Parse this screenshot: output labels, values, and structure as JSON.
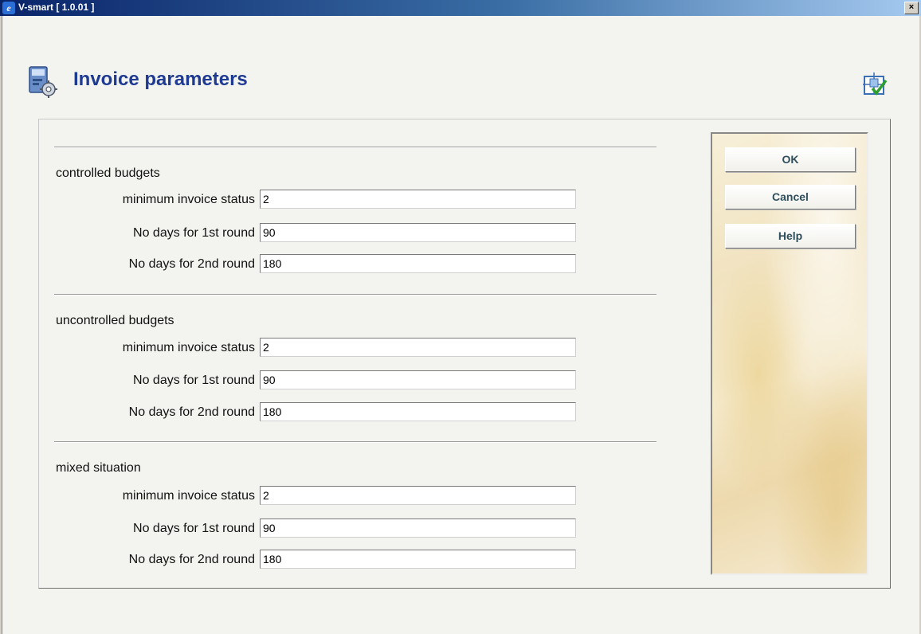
{
  "window": {
    "title": "V-smart [ 1.0.01 ]",
    "close_glyph": "×"
  },
  "page": {
    "title": "Invoice parameters"
  },
  "icons": {
    "app": "ie-icon",
    "page": "parameters-icon",
    "help": "help-link-icon"
  },
  "sections": [
    {
      "label": "controlled budgets",
      "fields": [
        {
          "label": "minimum invoice status",
          "value": "2"
        },
        {
          "label": "No days for 1st round",
          "value": "90"
        },
        {
          "label": "No days for 2nd round",
          "value": "180"
        }
      ]
    },
    {
      "label": "uncontrolled budgets",
      "fields": [
        {
          "label": "minimum invoice status",
          "value": "2"
        },
        {
          "label": "No days for 1st round",
          "value": "90"
        },
        {
          "label": "No days for 2nd round",
          "value": "180"
        }
      ]
    },
    {
      "label": "mixed situation",
      "fields": [
        {
          "label": "minimum invoice status",
          "value": "2"
        },
        {
          "label": "No days for 1st round",
          "value": "90"
        },
        {
          "label": "No days for 2nd round",
          "value": "180"
        }
      ]
    }
  ],
  "buttons": {
    "ok": "OK",
    "cancel": "Cancel",
    "help": "Help"
  },
  "colors": {
    "title": "#1f3a93",
    "button_text": "#2e4f5c",
    "titlebar": "#0a246a"
  }
}
